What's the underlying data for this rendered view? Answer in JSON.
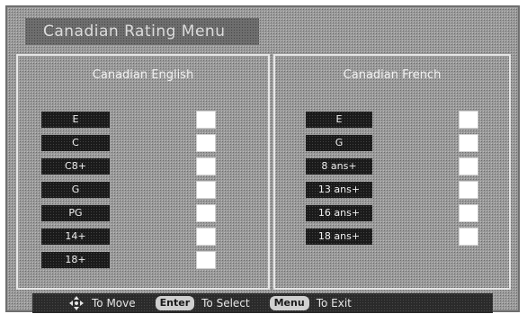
{
  "title": "Canadian Rating Menu",
  "english": {
    "heading": "Canadian English",
    "ratings": [
      "E",
      "C",
      "C8+",
      "G",
      "PG",
      "14+",
      "18+"
    ]
  },
  "french": {
    "heading": "Canadian French",
    "ratings": [
      "E",
      "G",
      "8 ans+",
      "13 ans+",
      "16 ans+",
      "18 ans+"
    ]
  },
  "help": {
    "move_icon": "directional-pad-icon",
    "move_text": "To Move",
    "enter_key": "Enter",
    "select_text": "To Select",
    "menu_key": "Menu",
    "exit_text": "To Exit"
  }
}
